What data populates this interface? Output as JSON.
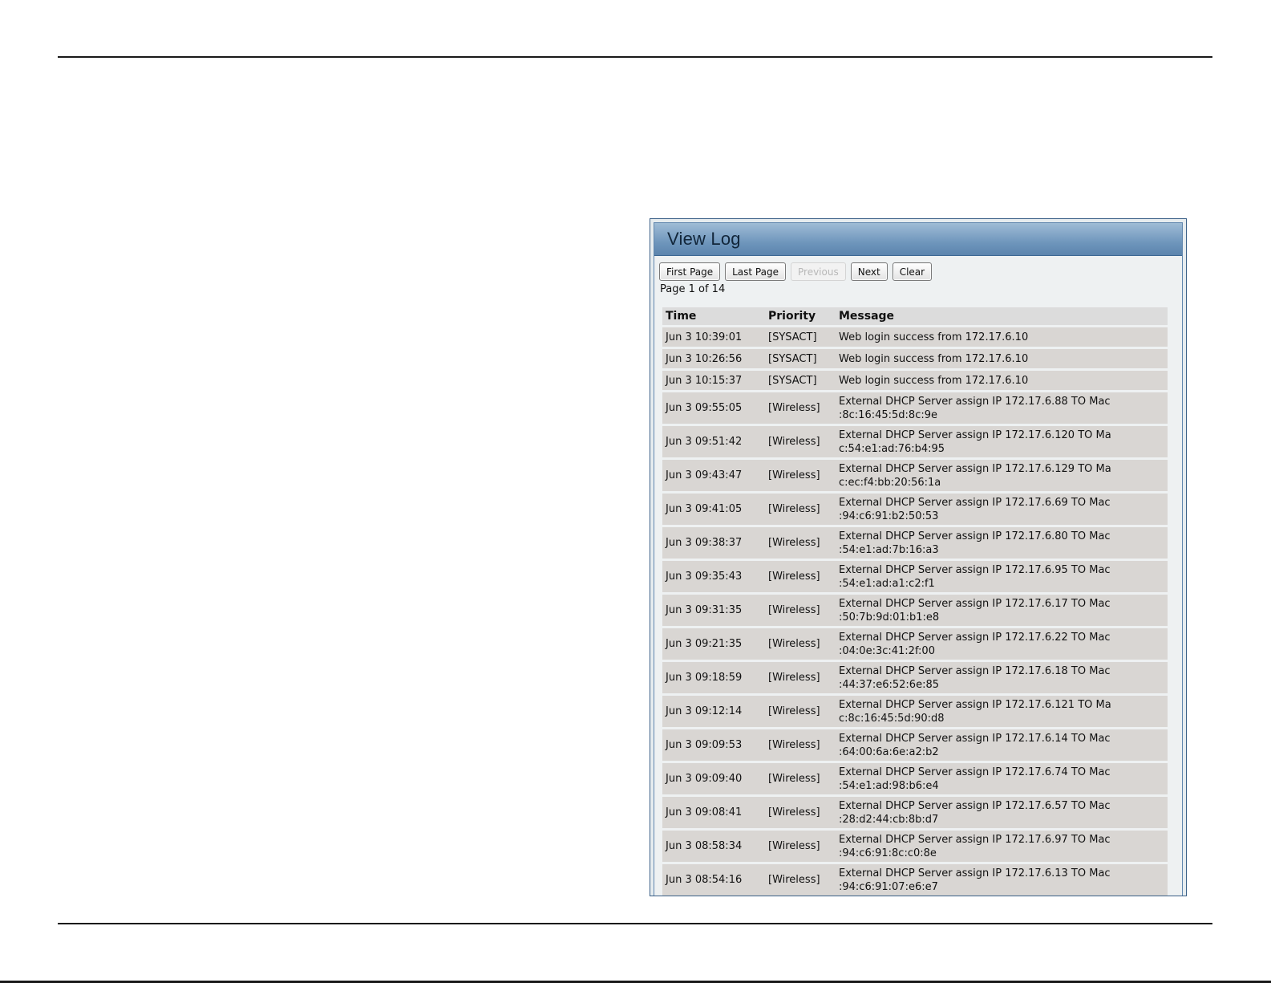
{
  "panel": {
    "title": "View Log"
  },
  "toolbar": {
    "first_page": "First Page",
    "last_page": "Last Page",
    "previous": "Previous",
    "next": "Next",
    "clear": "Clear"
  },
  "pagination": {
    "text": "Page 1 of 14",
    "current": 1,
    "total": 14
  },
  "table": {
    "headers": [
      "Time",
      "Priority",
      "Message"
    ],
    "rows": [
      {
        "time": "Jun 3 10:39:01",
        "priority": "[SYSACT]",
        "message": [
          "Web login success from 172.17.6.10"
        ]
      },
      {
        "time": "Jun 3 10:26:56",
        "priority": "[SYSACT]",
        "message": [
          "Web login success from 172.17.6.10"
        ]
      },
      {
        "time": "Jun 3 10:15:37",
        "priority": "[SYSACT]",
        "message": [
          "Web login success from 172.17.6.10"
        ]
      },
      {
        "time": "Jun 3 09:55:05",
        "priority": "[Wireless]",
        "message": [
          "External DHCP Server assign IP 172.17.6.88 TO Mac",
          ":8c:16:45:5d:8c:9e"
        ]
      },
      {
        "time": "Jun 3 09:51:42",
        "priority": "[Wireless]",
        "message": [
          "External DHCP Server assign IP 172.17.6.120 TO Ma",
          "c:54:e1:ad:76:b4:95"
        ]
      },
      {
        "time": "Jun 3 09:43:47",
        "priority": "[Wireless]",
        "message": [
          "External DHCP Server assign IP 172.17.6.129 TO Ma",
          "c:ec:f4:bb:20:56:1a"
        ]
      },
      {
        "time": "Jun 3 09:41:05",
        "priority": "[Wireless]",
        "message": [
          "External DHCP Server assign IP 172.17.6.69 TO Mac",
          ":94:c6:91:b2:50:53"
        ]
      },
      {
        "time": "Jun 3 09:38:37",
        "priority": "[Wireless]",
        "message": [
          "External DHCP Server assign IP 172.17.6.80 TO Mac",
          ":54:e1:ad:7b:16:a3"
        ]
      },
      {
        "time": "Jun 3 09:35:43",
        "priority": "[Wireless]",
        "message": [
          "External DHCP Server assign IP 172.17.6.95 TO Mac",
          ":54:e1:ad:a1:c2:f1"
        ]
      },
      {
        "time": "Jun 3 09:31:35",
        "priority": "[Wireless]",
        "message": [
          "External DHCP Server assign IP 172.17.6.17 TO Mac",
          ":50:7b:9d:01:b1:e8"
        ]
      },
      {
        "time": "Jun 3 09:21:35",
        "priority": "[Wireless]",
        "message": [
          "External DHCP Server assign IP 172.17.6.22 TO Mac",
          ":04:0e:3c:41:2f:00"
        ]
      },
      {
        "time": "Jun 3 09:18:59",
        "priority": "[Wireless]",
        "message": [
          "External DHCP Server assign IP 172.17.6.18 TO Mac",
          ":44:37:e6:52:6e:85"
        ]
      },
      {
        "time": "Jun 3 09:12:14",
        "priority": "[Wireless]",
        "message": [
          "External DHCP Server assign IP 172.17.6.121 TO Ma",
          "c:8c:16:45:5d:90:d8"
        ]
      },
      {
        "time": "Jun 3 09:09:53",
        "priority": "[Wireless]",
        "message": [
          "External DHCP Server assign IP 172.17.6.14 TO Mac",
          ":64:00:6a:6e:a2:b2"
        ]
      },
      {
        "time": "Jun 3 09:09:40",
        "priority": "[Wireless]",
        "message": [
          "External DHCP Server assign IP 172.17.6.74 TO Mac",
          ":54:e1:ad:98:b6:e4"
        ]
      },
      {
        "time": "Jun 3 09:08:41",
        "priority": "[Wireless]",
        "message": [
          "External DHCP Server assign IP 172.17.6.57 TO Mac",
          ":28:d2:44:cb:8b:d7"
        ]
      },
      {
        "time": "Jun 3 08:58:34",
        "priority": "[Wireless]",
        "message": [
          "External DHCP Server assign IP 172.17.6.97 TO Mac",
          ":94:c6:91:8c:c0:8e"
        ]
      },
      {
        "time": "Jun 3 08:54:16",
        "priority": "[Wireless]",
        "message": [
          "External DHCP Server assign IP 172.17.6.13 TO Mac",
          ":94:c6:91:07:e6:e7"
        ]
      }
    ]
  }
}
